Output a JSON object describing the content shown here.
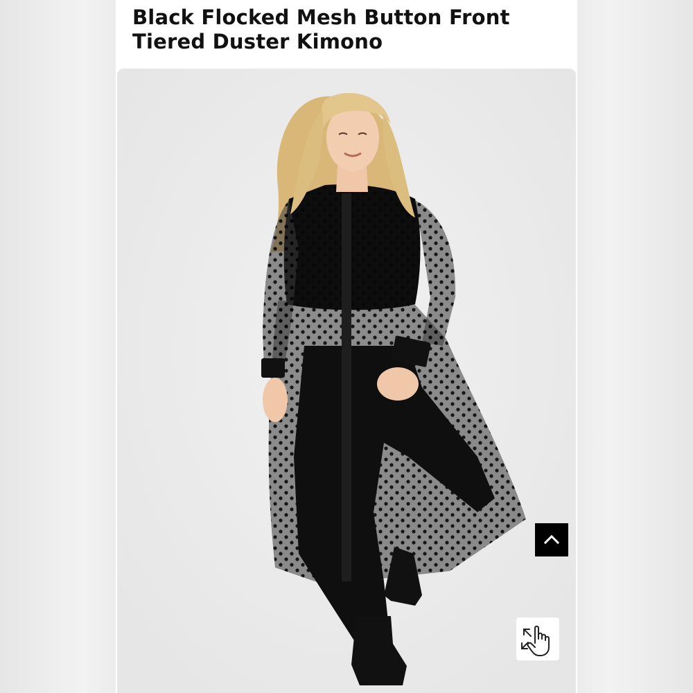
{
  "product": {
    "title": "Black Flocked Mesh Button Front Tiered Duster Kimono"
  },
  "photo": {
    "subject": "model-wearing-sheer-black-polka-dot-duster"
  },
  "controls": {
    "back_to_top_icon": "chevron-up-icon",
    "zoom_icon": "hand-pointer-expand-icon"
  },
  "colors": {
    "page_bg": "#ececec",
    "card_bg": "#ffffff",
    "photo_bg": "#ebebeb",
    "title_text": "#111111",
    "button_bg": "#000000"
  }
}
